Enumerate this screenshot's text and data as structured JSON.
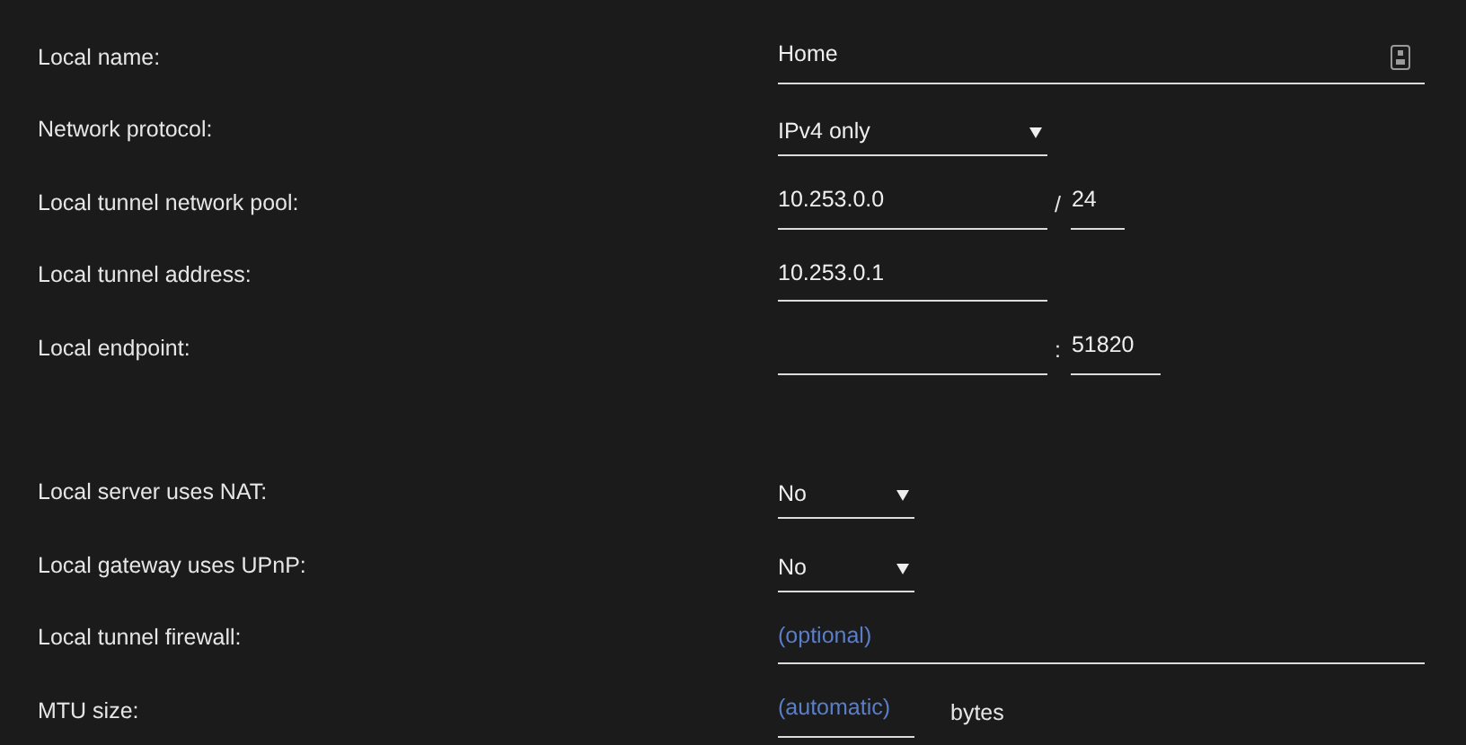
{
  "sections": [
    {
      "rows": [
        {
          "kind": "wide-text",
          "label": "Local name:",
          "value": "Home",
          "icon": true
        },
        {
          "kind": "select",
          "label": "Network protocol:",
          "value": "IPv4 only"
        },
        {
          "kind": "cidr",
          "label": "Local tunnel network pool:",
          "value": "10.253.0.0",
          "separator": "/",
          "extra": "24"
        },
        {
          "kind": "text",
          "label": "Local tunnel address:",
          "value": "10.253.0.1"
        },
        {
          "kind": "endpoint",
          "label": "Local endpoint:",
          "separator": ":",
          "extra": "51820"
        }
      ]
    },
    {
      "rows": [
        {
          "kind": "short-select",
          "label": "Local server uses NAT:",
          "value": "No"
        },
        {
          "kind": "short-select",
          "label": "Local gateway uses UPnP:",
          "value": "No"
        },
        {
          "kind": "wide-text",
          "label": "Local tunnel firewall:",
          "placeholder": "(optional)"
        },
        {
          "kind": "short-text",
          "label": "MTU size:",
          "placeholder": "(automatic)",
          "suffix": "bytes"
        }
      ]
    }
  ]
}
